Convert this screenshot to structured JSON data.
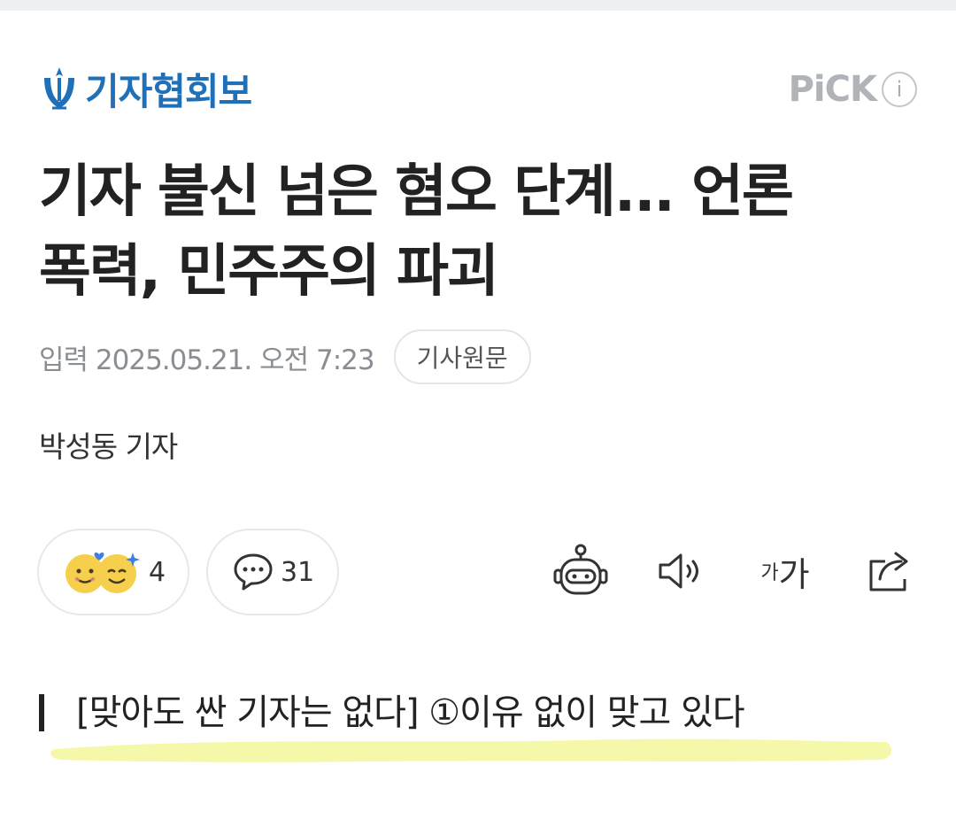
{
  "header": {
    "brand_name": "기자협회보",
    "pick_label": "PiCK",
    "info_label": "i"
  },
  "article": {
    "title_line1": "기자 불신 넘은 혐오 단계... 언론",
    "title_line2": "폭력, 민주주의 파괴",
    "date": "입력 2025.05.21. 오전 7:23",
    "origin_label": "기사원문",
    "author": "박성동 기자",
    "subheading": "[맞아도 싼 기자는 없다] ①이유 없이 맞고 있다"
  },
  "actions": {
    "reaction_count": "4",
    "comment_count": "31",
    "font_size_small": "가",
    "font_size_big": "가"
  },
  "icons": [
    "brand-logo-icon",
    "info-icon",
    "reaction-emoji-icon",
    "comment-bubble-icon",
    "ai-robot-icon",
    "speaker-icon",
    "share-icon"
  ],
  "colors": {
    "brand": "#1f6fb9",
    "highlight": "#f4f79a",
    "pick": "#b0b4b9"
  }
}
